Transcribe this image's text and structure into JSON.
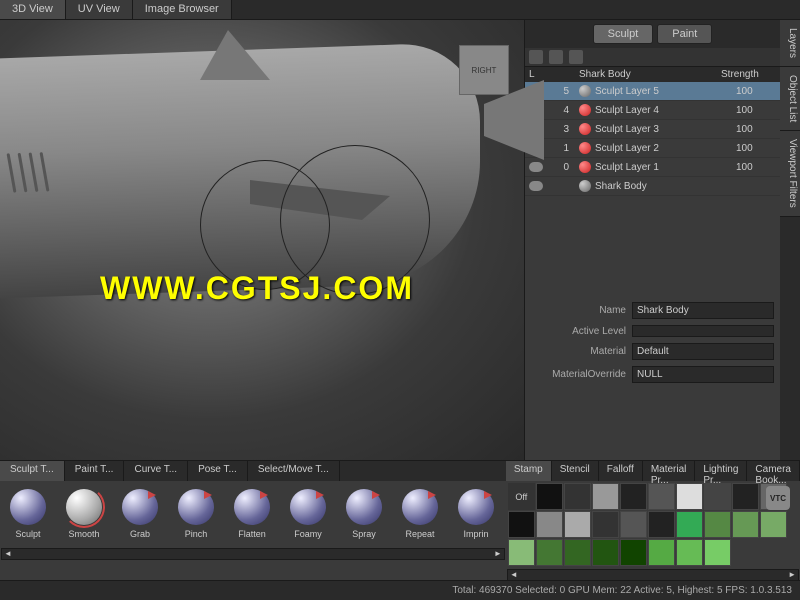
{
  "topTabs": [
    "3D View",
    "UV View",
    "Image Browser"
  ],
  "activeTopTab": 0,
  "modeButtons": {
    "sculpt": "Sculpt",
    "paint": "Paint"
  },
  "sideTabs": [
    "Layers",
    "Object List",
    "Viewport Filters"
  ],
  "layerHeader": {
    "l": "L",
    "name": "Shark Body",
    "strength": "Strength"
  },
  "layers": [
    {
      "num": "5",
      "name": "Sculpt Layer 5",
      "strength": "100",
      "selected": true,
      "iconColor": "gray"
    },
    {
      "num": "4",
      "name": "Sculpt Layer 4",
      "strength": "100",
      "selected": false,
      "iconColor": "red"
    },
    {
      "num": "3",
      "name": "Sculpt Layer 3",
      "strength": "100",
      "selected": false,
      "iconColor": "red"
    },
    {
      "num": "1",
      "name": "Sculpt Layer 2",
      "strength": "100",
      "selected": false,
      "iconColor": "red"
    },
    {
      "num": "0",
      "name": "Sculpt Layer 1",
      "strength": "100",
      "selected": false,
      "iconColor": "red"
    },
    {
      "num": "",
      "name": "Shark Body",
      "strength": "",
      "selected": false,
      "iconColor": "gray"
    }
  ],
  "props": {
    "nameLabel": "Name",
    "nameValue": "Shark Body",
    "activeLevelLabel": "Active Level",
    "materialLabel": "Material",
    "materialValue": "Default",
    "materialOverrideLabel": "MaterialOverride",
    "materialOverrideValue": "NULL"
  },
  "toolTabs": [
    "Sculpt T...",
    "Paint T...",
    "Curve T...",
    "Pose T...",
    "Select/Move T..."
  ],
  "activeToolTab": 0,
  "tools": [
    {
      "label": "Sculpt",
      "accent": false,
      "cls": ""
    },
    {
      "label": "Smooth",
      "accent": false,
      "cls": "smooth"
    },
    {
      "label": "Grab",
      "accent": true,
      "cls": ""
    },
    {
      "label": "Pinch",
      "accent": true,
      "cls": ""
    },
    {
      "label": "Flatten",
      "accent": true,
      "cls": ""
    },
    {
      "label": "Foamy",
      "accent": true,
      "cls": ""
    },
    {
      "label": "Spray",
      "accent": true,
      "cls": ""
    },
    {
      "label": "Repeat",
      "accent": true,
      "cls": ""
    },
    {
      "label": "Imprin",
      "accent": true,
      "cls": ""
    }
  ],
  "stampTabs": [
    "Stamp",
    "Stencil",
    "Falloff",
    "Material Pr...",
    "Lighting Pr...",
    "Camera Book..."
  ],
  "stampOff": "Off",
  "navCube": "RIGHT",
  "watermark": "WWW.CGTSJ.COM",
  "statusBar": "Total: 469370  Selected: 0 GPU Mem: 22  Active: 5, Highest: 5  FPS: 1.0.3.513",
  "vtc": "VTC"
}
